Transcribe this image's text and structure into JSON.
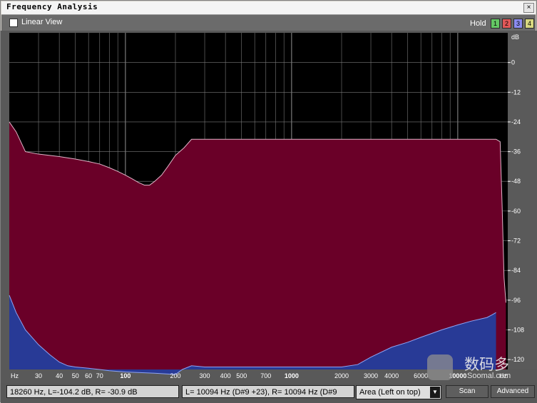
{
  "window": {
    "title": "Frequency Analysis",
    "close_glyph": "×"
  },
  "toolbar": {
    "linear_view_label": "Linear View",
    "linear_view_checked": false,
    "hold_label": "Hold",
    "hold_buttons": [
      {
        "label": "1",
        "color": "#64c864"
      },
      {
        "label": "2",
        "color": "#e05858"
      },
      {
        "label": "3",
        "color": "#8c8cf0"
      },
      {
        "label": "4",
        "color": "#d8d880"
      }
    ]
  },
  "chart_data": {
    "type": "area",
    "x_scale": "log",
    "xlim": [
      20,
      20000
    ],
    "ylim": [
      -124,
      12
    ],
    "xunit": "Hz",
    "yunit": "dB",
    "x_ticks": [
      {
        "value": 30,
        "label": "30",
        "bold": false
      },
      {
        "value": 40,
        "label": "40",
        "bold": false
      },
      {
        "value": 50,
        "label": "50",
        "bold": false
      },
      {
        "value": 60,
        "label": "60",
        "bold": false
      },
      {
        "value": 70,
        "label": "70",
        "bold": false
      },
      {
        "value": 100,
        "label": "100",
        "bold": true
      },
      {
        "value": 200,
        "label": "200",
        "bold": false
      },
      {
        "value": 300,
        "label": "300",
        "bold": false
      },
      {
        "value": 400,
        "label": "400",
        "bold": false
      },
      {
        "value": 500,
        "label": "500",
        "bold": false
      },
      {
        "value": 700,
        "label": "700",
        "bold": false
      },
      {
        "value": 1000,
        "label": "1000",
        "bold": true
      },
      {
        "value": 2000,
        "label": "2000",
        "bold": false
      },
      {
        "value": 3000,
        "label": "3000",
        "bold": false
      },
      {
        "value": 4000,
        "label": "4000",
        "bold": false
      },
      {
        "value": 6000,
        "label": "6000",
        "bold": false
      },
      {
        "value": 10000,
        "label": "10000",
        "bold": true
      }
    ],
    "y_ticks": [
      {
        "value": 0,
        "label": "0"
      },
      {
        "value": -12,
        "label": "-12"
      },
      {
        "value": -24,
        "label": "-24"
      },
      {
        "value": -36,
        "label": "-36"
      },
      {
        "value": -48,
        "label": "-48"
      },
      {
        "value": -60,
        "label": "-60"
      },
      {
        "value": -72,
        "label": "-72"
      },
      {
        "value": -84,
        "label": "-84"
      },
      {
        "value": -96,
        "label": "-96"
      },
      {
        "value": -108,
        "label": "-108"
      },
      {
        "value": -120,
        "label": "-120"
      }
    ],
    "grid": true,
    "colors": {
      "background": "#000000",
      "grid": "#7a7a7a",
      "left": "#6a0028",
      "left_edge": "#e0b4c8",
      "right": "#283a96",
      "right_edge": "#8ea4f4"
    },
    "series": [
      {
        "name": "L",
        "x": [
          20,
          22,
          25,
          30,
          40,
          50,
          60,
          70,
          80,
          90,
          100,
          110,
          120,
          130,
          140,
          150,
          165,
          180,
          200,
          225,
          250,
          300,
          400,
          600,
          1000,
          2000,
          4000,
          6000,
          10000,
          15000,
          17000,
          18000,
          18500,
          19000,
          19500
        ],
        "y": [
          -24,
          -28,
          -36,
          -37,
          -38,
          -39,
          -40,
          -41,
          -42.5,
          -44,
          -45.5,
          -47,
          -48.5,
          -49.5,
          -49.5,
          -48,
          -45.5,
          -42,
          -37.5,
          -34.5,
          -31,
          -31,
          -31,
          -31,
          -31,
          -31,
          -31,
          -31,
          -31,
          -31,
          -31,
          -32,
          -58,
          -87,
          -97
        ]
      },
      {
        "name": "R",
        "x": [
          20,
          22,
          25,
          30,
          35,
          40,
          45,
          50,
          60,
          70,
          80,
          100,
          150,
          200,
          220,
          250,
          300,
          500,
          1000,
          1500,
          2000,
          2500,
          3000,
          4000,
          5000,
          6000,
          8000,
          10000,
          12000,
          15000,
          16000,
          17000
        ],
        "y": [
          -94,
          -101,
          -108,
          -114,
          -118,
          -121,
          -122.5,
          -123,
          -123.5,
          -124,
          -124.5,
          -125,
          -125.5,
          -126,
          -124,
          -122.5,
          -123,
          -123,
          -123,
          -123,
          -123,
          -122,
          -119,
          -115,
          -113,
          -111,
          -108,
          -106,
          -104.5,
          -103,
          -102,
          -101
        ]
      }
    ]
  },
  "status": {
    "cursor_readout": "18260 Hz, L=-104.2 dB, R= -30.9 dB",
    "peak_readout": "L=  10094 Hz (D#9 +23), R=  10094 Hz (D#9",
    "view_mode": "Area (Left on top)",
    "scan_label": "Scan",
    "advanced_label": "Advanced"
  },
  "watermark": {
    "text": "数码多",
    "sub": "Soomal.com"
  }
}
